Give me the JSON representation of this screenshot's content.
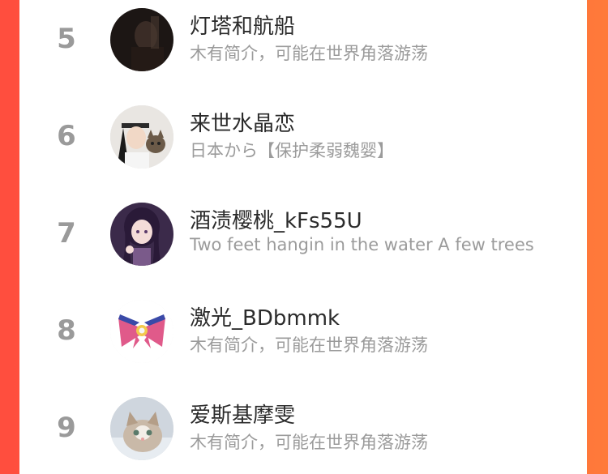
{
  "ranking": {
    "rows": [
      {
        "rank": "5",
        "name": "灯塔和航船",
        "bio": "木有简介，可能在世界角落游荡",
        "avatar": "dark-portrait"
      },
      {
        "rank": "6",
        "name": "来世水晶恋",
        "bio": "日本から【保护柔弱魏婴】",
        "avatar": "cosplay-with-cat"
      },
      {
        "rank": "7",
        "name": "酒渍樱桃_kFs55U",
        "bio": "Two feet hangin in the water A few trees",
        "avatar": "anime-girl"
      },
      {
        "rank": "8",
        "name": "激光_BDbmmk",
        "bio": "木有简介，可能在世界角落游荡",
        "avatar": "sailor-bow"
      },
      {
        "rank": "9",
        "name": "爱斯基摩雯",
        "bio": "木有简介，可能在世界角落游荡",
        "avatar": "kitten"
      }
    ]
  },
  "colors": {
    "background_left": "#ff4e3e",
    "background_right": "#ff7a3a",
    "card": "#ffffff",
    "rank": "#9a9a9a",
    "name": "#2b2b2b",
    "bio": "#9b9b9b"
  }
}
